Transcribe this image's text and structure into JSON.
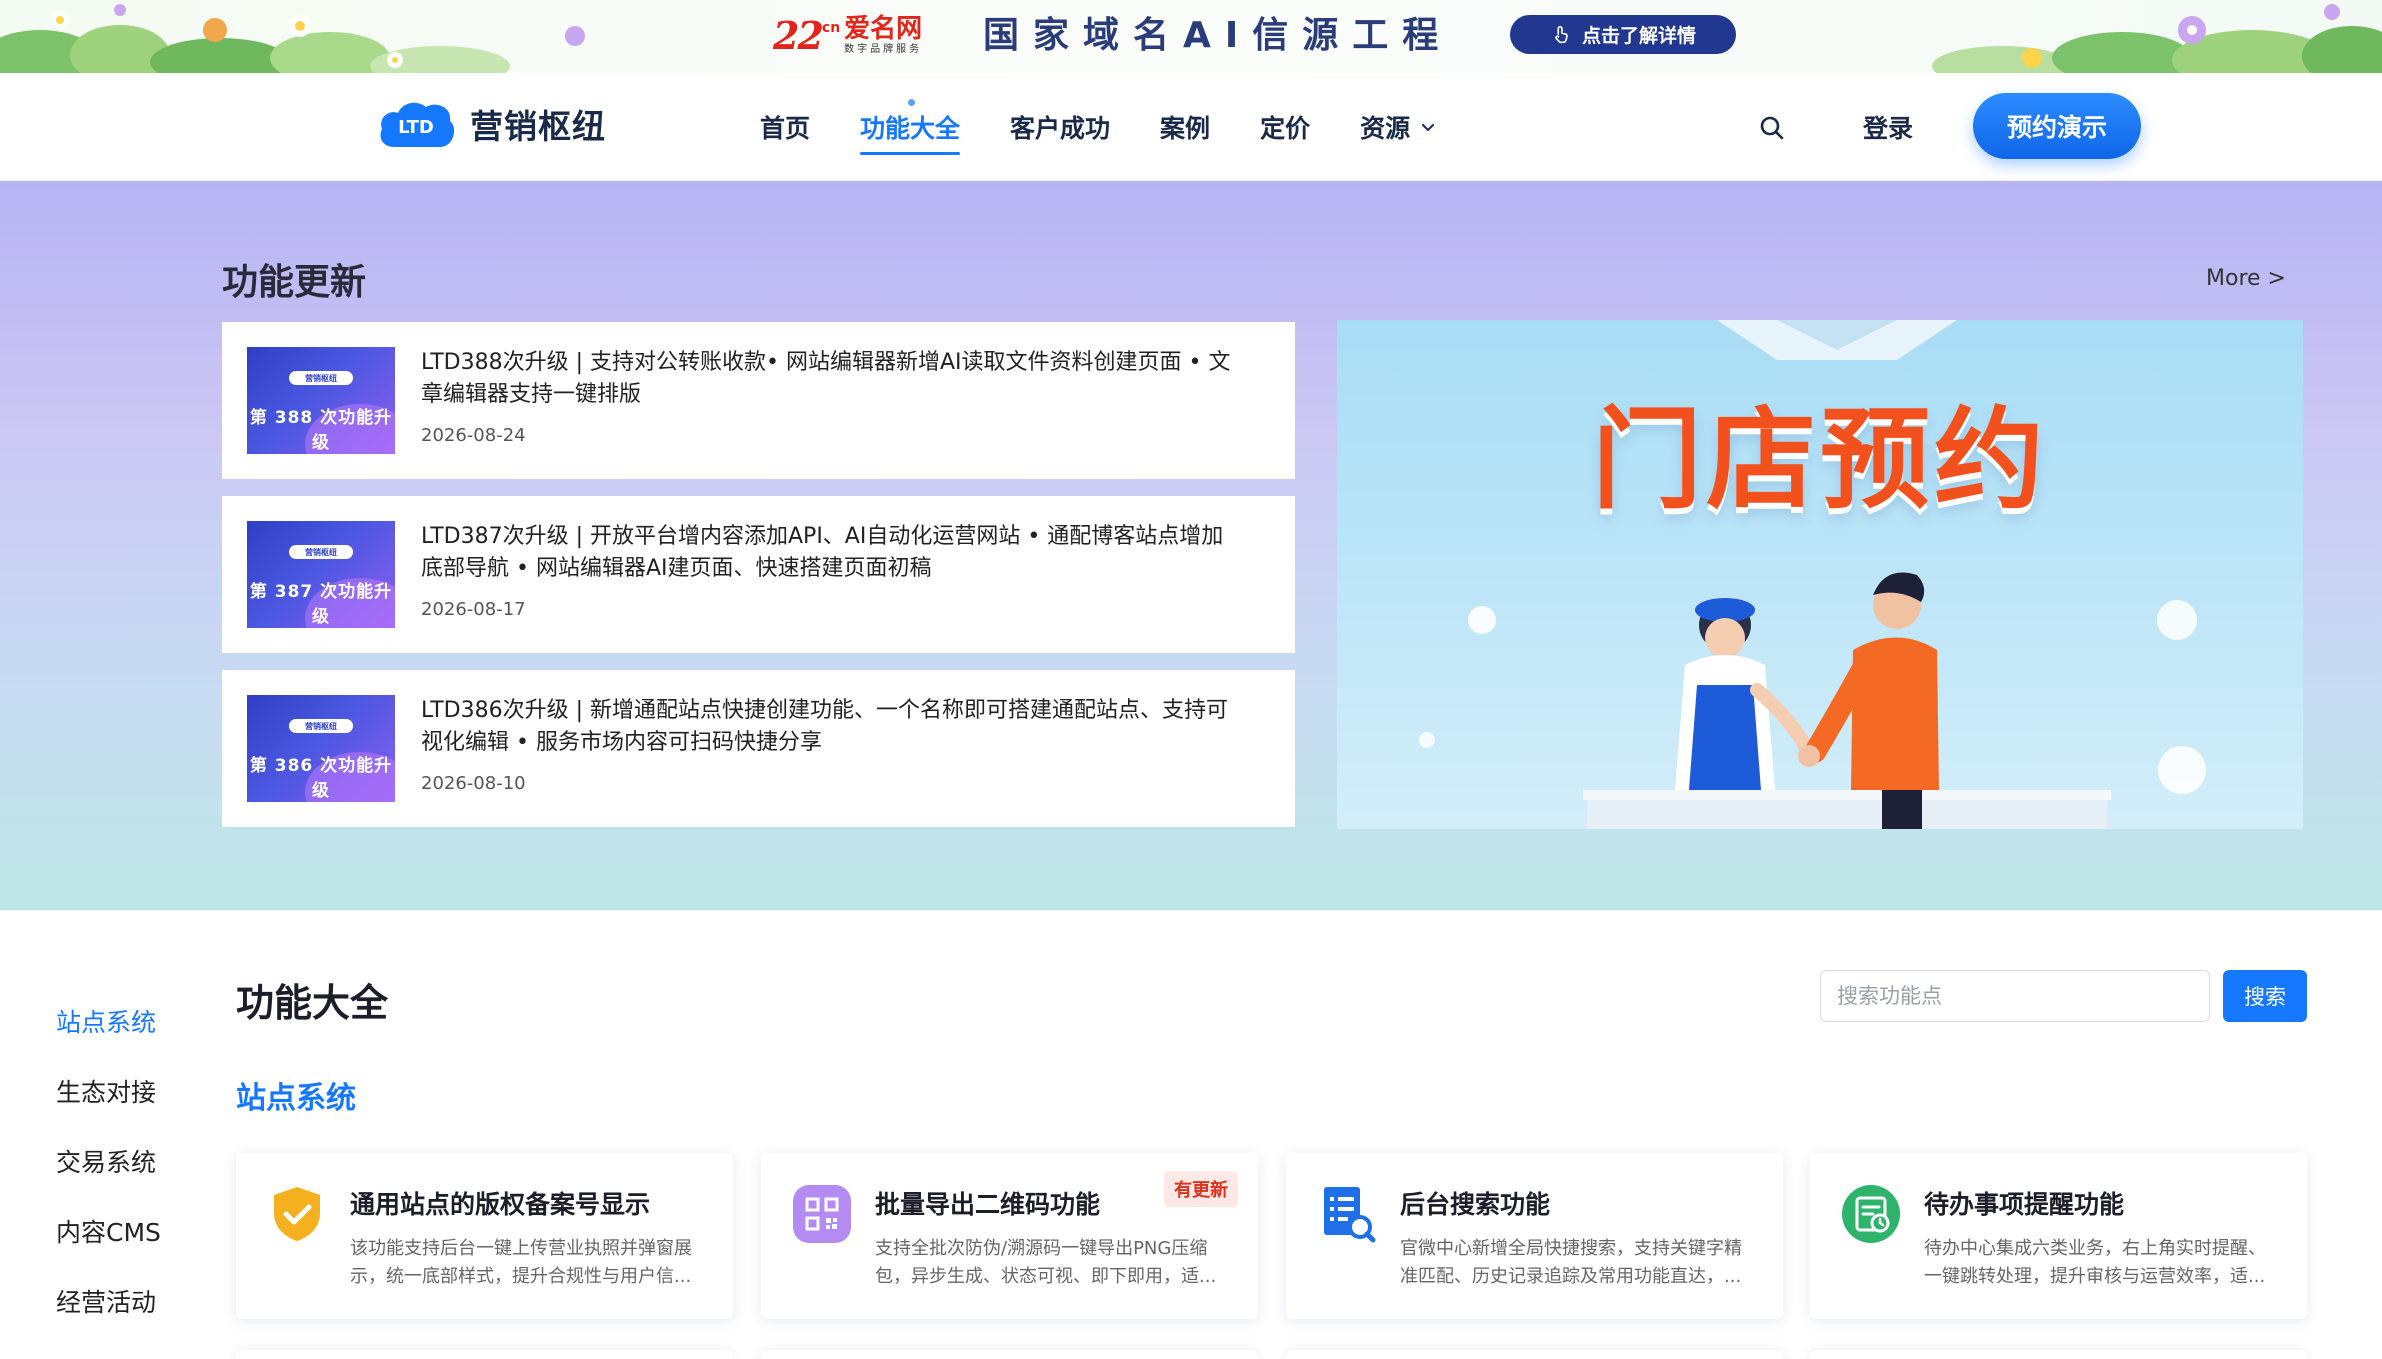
{
  "promo": {
    "logo_number": "22",
    "logo_sup": "cn",
    "logo_name": "爱名网",
    "logo_tagline": "数字品牌服务",
    "title": "国家域名AI信源工程",
    "button_label": "点击了解详情"
  },
  "nav": {
    "brand_name": "营销枢纽",
    "brand_mark": "LTD",
    "links": [
      {
        "label": "首页"
      },
      {
        "label": "功能大全"
      },
      {
        "label": "客户成功"
      },
      {
        "label": "案例"
      },
      {
        "label": "定价"
      },
      {
        "label": "资源"
      }
    ],
    "login_label": "登录",
    "demo_label": "预约演示"
  },
  "updates": {
    "title": "功能更新",
    "more_label": "More >",
    "items": [
      {
        "thumb_pill": "营销枢纽",
        "thumb_text": "第 388 次功能升级",
        "text": "LTD388次升级 | 支持对公转账收款• 网站编辑器新增AI读取文件资料创建页面 • 文章编辑器支持一键排版",
        "date": "2026-08-24"
      },
      {
        "thumb_pill": "营销枢纽",
        "thumb_text": "第 387 次功能升级",
        "text": "LTD387次升级 | 开放平台增内容添加API、AI自动化运营网站 • 通配博客站点增加底部导航 • 网站编辑器AI建页面、快速搭建页面初稿",
        "date": "2026-08-17"
      },
      {
        "thumb_pill": "营销枢纽",
        "thumb_text": "第 386 次功能升级",
        "text": "LTD386次升级 | 新增通配站点快捷创建功能、一个名称即可搭建通配站点、支持可视化编辑 • 服务市场内容可扫码快捷分享",
        "date": "2026-08-10"
      }
    ],
    "banner_headline": "门店预约"
  },
  "library": {
    "title": "功能大全",
    "search_placeholder": "搜索功能点",
    "search_button": "搜索",
    "sidebar": [
      "站点系统",
      "生态对接",
      "交易系统",
      "内容CMS",
      "经营活动"
    ],
    "section_title": "站点系统",
    "cards": [
      {
        "icon": "shield-check-icon",
        "title": "通用站点的版权备案号显示",
        "desc": "该功能支持后台一键上传营业执照并弹窗展示，统一底部样式，提升合规性与用户信...",
        "badge": ""
      },
      {
        "icon": "qrcode-icon",
        "title": "批量导出二维码功能",
        "desc": "支持全批次防伪/溯源码一键导出PNG压缩包，异步生成、状态可视、即下即用，适...",
        "badge": "有更新"
      },
      {
        "icon": "doc-search-icon",
        "title": "后台搜索功能",
        "desc": "官微中心新增全局快捷搜索，支持关键字精准匹配、历史记录追踪及常用功能直达，...",
        "badge": ""
      },
      {
        "icon": "todo-clock-icon",
        "title": "待办事项提醒功能",
        "desc": "待办中心集成六类业务，右上角实时提醒、一键跳转处理，提升审核与运营效率，适...",
        "badge": ""
      }
    ]
  },
  "colors": {
    "accent": "#1677ff",
    "promo_button": "#22378f",
    "badge_red": "#e0301e",
    "banner_headline": "#f2501c"
  }
}
